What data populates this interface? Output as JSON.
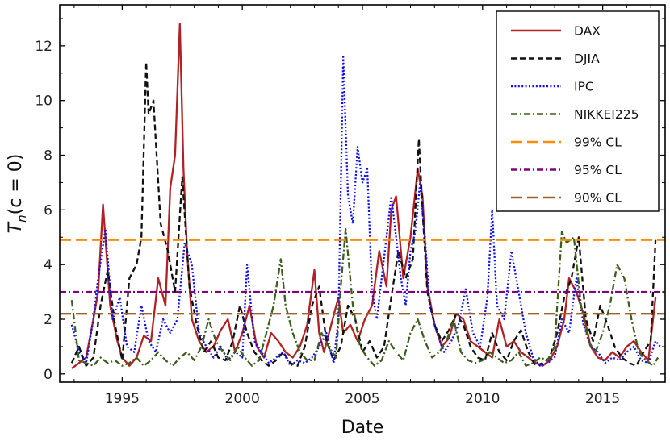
{
  "chart_data": {
    "type": "line",
    "xlabel": "Date",
    "ylabel": "T_n(c = 0)",
    "xlim": [
      1992.4,
      2017.6
    ],
    "ylim": [
      -0.3,
      13.5
    ],
    "x_ticks": [
      1995,
      2000,
      2005,
      2010,
      2015
    ],
    "y_ticks": [
      0,
      2,
      4,
      6,
      8,
      10,
      12
    ],
    "grid": false,
    "legend_position": "top-right",
    "series": [
      {
        "name": "DAX",
        "color": "#b22222",
        "style": "solid",
        "x": [
          1992.9,
          1993.2,
          1993.5,
          1993.8,
          1994.0,
          1994.2,
          1994.5,
          1994.8,
          1995.0,
          1995.3,
          1995.6,
          1995.9,
          1996.2,
          1996.5,
          1996.8,
          1997.0,
          1997.2,
          1997.4,
          1997.55,
          1997.7,
          1997.9,
          1998.2,
          1998.5,
          1998.8,
          1999.1,
          1999.4,
          1999.7,
          2000.0,
          2000.3,
          2000.6,
          2000.9,
          2001.2,
          2001.5,
          2001.8,
          2002.1,
          2002.4,
          2002.7,
          2003.0,
          2003.2,
          2003.4,
          2003.7,
          2004.0,
          2004.2,
          2004.5,
          2004.8,
          2005.1,
          2005.4,
          2005.7,
          2006.0,
          2006.2,
          2006.4,
          2006.7,
          2007.0,
          2007.3,
          2007.5,
          2007.7,
          2008.0,
          2008.3,
          2008.6,
          2008.9,
          2009.2,
          2009.5,
          2009.8,
          2010.1,
          2010.4,
          2010.7,
          2011.0,
          2011.3,
          2011.6,
          2011.9,
          2012.2,
          2012.5,
          2012.8,
          2013.1,
          2013.4,
          2013.6,
          2013.9,
          2014.2,
          2014.5,
          2014.8,
          2015.1,
          2015.4,
          2015.7,
          2016.0,
          2016.3,
          2016.6,
          2016.9,
          2017.2
        ],
        "y": [
          0.2,
          0.4,
          0.6,
          2.0,
          3.0,
          6.2,
          2.5,
          1.2,
          0.6,
          0.3,
          0.6,
          1.4,
          1.2,
          3.5,
          2.5,
          6.8,
          8.0,
          12.8,
          7.5,
          4.5,
          2.0,
          1.2,
          0.8,
          1.0,
          1.6,
          2.0,
          0.8,
          1.5,
          2.5,
          1.0,
          0.6,
          1.5,
          1.2,
          0.8,
          0.6,
          1.0,
          1.8,
          3.8,
          1.5,
          0.8,
          1.8,
          2.8,
          1.5,
          1.8,
          1.2,
          2.0,
          2.5,
          4.5,
          3.2,
          6.0,
          6.5,
          3.5,
          5.0,
          7.5,
          6.5,
          3.2,
          1.8,
          1.0,
          1.3,
          2.2,
          2.0,
          1.2,
          1.0,
          0.8,
          0.6,
          2.0,
          1.0,
          1.2,
          0.8,
          0.6,
          0.4,
          0.3,
          0.5,
          1.0,
          2.0,
          3.5,
          3.0,
          2.2,
          1.0,
          0.6,
          0.5,
          0.8,
          0.6,
          1.0,
          1.2,
          0.8,
          0.5,
          2.8
        ]
      },
      {
        "name": "DJIA",
        "color": "#111111",
        "style": "dashed",
        "x": [
          1992.9,
          1993.2,
          1993.5,
          1993.8,
          1994.1,
          1994.4,
          1994.7,
          1995.0,
          1995.3,
          1995.6,
          1995.8,
          1996.0,
          1996.1,
          1996.3,
          1996.6,
          1996.9,
          1997.2,
          1997.5,
          1997.8,
          1998.1,
          1998.4,
          1998.7,
          1999.0,
          1999.3,
          1999.6,
          1999.9,
          2000.2,
          2000.5,
          2000.8,
          2001.1,
          2001.4,
          2001.7,
          2002.0,
          2002.3,
          2002.6,
          2002.9,
          2003.2,
          2003.5,
          2003.8,
          2004.1,
          2004.4,
          2004.7,
          2005.0,
          2005.3,
          2005.6,
          2005.9,
          2006.2,
          2006.5,
          2006.8,
          2007.1,
          2007.35,
          2007.5,
          2007.7,
          2008.0,
          2008.3,
          2008.6,
          2008.9,
          2009.2,
          2009.5,
          2009.8,
          2010.1,
          2010.4,
          2010.7,
          2011.0,
          2011.3,
          2011.6,
          2011.9,
          2012.2,
          2012.5,
          2012.8,
          2013.1,
          2013.4,
          2013.7,
          2014.0,
          2014.3,
          2014.6,
          2014.9,
          2015.2,
          2015.5,
          2015.8,
          2016.1,
          2016.4,
          2016.7,
          2017.0,
          2017.2
        ],
        "y": [
          0.4,
          1.0,
          0.3,
          0.6,
          2.5,
          3.8,
          1.8,
          0.5,
          3.5,
          4.0,
          5.0,
          11.4,
          9.5,
          10.0,
          5.5,
          4.5,
          3.0,
          7.2,
          3.2,
          1.8,
          0.8,
          1.2,
          0.6,
          0.5,
          1.2,
          2.5,
          1.5,
          0.8,
          0.5,
          0.3,
          0.5,
          0.8,
          0.4,
          0.3,
          1.0,
          2.5,
          3.2,
          1.2,
          0.5,
          1.0,
          2.5,
          2.0,
          0.8,
          1.2,
          0.6,
          1.0,
          2.8,
          4.5,
          3.5,
          4.2,
          8.6,
          6.0,
          3.0,
          1.8,
          1.2,
          1.6,
          2.2,
          1.8,
          1.0,
          0.6,
          0.5,
          1.5,
          0.8,
          0.5,
          1.2,
          1.6,
          0.8,
          0.3,
          0.4,
          0.6,
          1.5,
          2.8,
          3.5,
          5.0,
          2.0,
          1.2,
          2.5,
          1.8,
          1.0,
          0.6,
          0.4,
          0.3,
          0.8,
          1.2,
          4.9
        ]
      },
      {
        "name": "IPC",
        "color": "#1010e8",
        "style": "dotted",
        "x": [
          1992.9,
          1993.2,
          1993.5,
          1993.8,
          1994.0,
          1994.3,
          1994.6,
          1994.9,
          1995.2,
          1995.5,
          1995.8,
          1996.1,
          1996.4,
          1996.7,
          1997.0,
          1997.3,
          1997.6,
          1997.9,
          1998.2,
          1998.5,
          1998.8,
          1999.1,
          1999.4,
          1999.7,
          2000.0,
          2000.2,
          2000.5,
          2000.8,
          2001.1,
          2001.4,
          2001.7,
          2002.0,
          2002.3,
          2002.6,
          2002.9,
          2003.2,
          2003.5,
          2003.8,
          2004.0,
          2004.2,
          2004.4,
          2004.6,
          2004.8,
          2005.0,
          2005.2,
          2005.4,
          2005.6,
          2005.8,
          2006.0,
          2006.2,
          2006.4,
          2006.6,
          2006.8,
          2007.0,
          2007.2,
          2007.4,
          2007.6,
          2007.8,
          2008.1,
          2008.4,
          2008.7,
          2009.0,
          2009.3,
          2009.6,
          2009.9,
          2010.2,
          2010.4,
          2010.6,
          2010.9,
          2011.2,
          2011.5,
          2011.8,
          2012.1,
          2012.4,
          2012.7,
          2013.0,
          2013.3,
          2013.6,
          2013.9,
          2014.2,
          2014.5,
          2014.8,
          2015.1,
          2015.4,
          2015.7,
          2016.0,
          2016.3,
          2016.6,
          2016.9,
          2017.2,
          2017.4
        ],
        "y": [
          1.8,
          0.8,
          0.4,
          2.0,
          3.5,
          5.3,
          2.0,
          2.8,
          1.0,
          0.8,
          2.5,
          1.2,
          0.8,
          2.0,
          1.5,
          2.0,
          4.8,
          4.0,
          1.5,
          1.0,
          0.6,
          1.0,
          0.5,
          0.8,
          0.6,
          4.0,
          1.2,
          0.8,
          0.4,
          0.6,
          0.8,
          0.3,
          0.5,
          0.4,
          0.6,
          1.0,
          1.5,
          0.4,
          2.0,
          11.6,
          6.5,
          5.5,
          8.3,
          7.0,
          7.5,
          3.0,
          2.0,
          3.5,
          5.0,
          6.5,
          5.0,
          3.5,
          2.5,
          4.5,
          5.2,
          7.0,
          5.0,
          2.5,
          1.5,
          0.8,
          1.2,
          1.8,
          3.1,
          1.5,
          1.0,
          2.8,
          6.0,
          2.5,
          2.0,
          4.5,
          3.0,
          1.5,
          0.6,
          0.3,
          0.4,
          0.6,
          2.0,
          1.5,
          3.5,
          1.8,
          1.0,
          0.8,
          0.4,
          0.6,
          0.5,
          0.8,
          1.0,
          0.5,
          0.4,
          1.2,
          1.0
        ]
      },
      {
        "name": "NIKKEI225",
        "color": "#3e5e1e",
        "style": "dashdot",
        "x": [
          1992.9,
          1993.2,
          1993.5,
          1993.8,
          1994.1,
          1994.4,
          1994.7,
          1995.0,
          1995.3,
          1995.6,
          1995.9,
          1996.2,
          1996.5,
          1996.8,
          1997.1,
          1997.4,
          1997.7,
          1998.0,
          1998.3,
          1998.6,
          1998.9,
          1999.2,
          1999.5,
          1999.8,
          2000.1,
          2000.4,
          2000.7,
          2001.0,
          2001.3,
          2001.6,
          2001.8,
          2002.1,
          2002.4,
          2002.7,
          2003.0,
          2003.3,
          2003.6,
          2003.9,
          2004.1,
          2004.3,
          2004.6,
          2004.9,
          2005.2,
          2005.5,
          2005.8,
          2006.1,
          2006.4,
          2006.7,
          2007.0,
          2007.3,
          2007.6,
          2007.9,
          2008.2,
          2008.5,
          2008.8,
          2009.1,
          2009.4,
          2009.7,
          2010.0,
          2010.3,
          2010.6,
          2010.9,
          2011.2,
          2011.5,
          2011.8,
          2012.1,
          2012.4,
          2012.7,
          2013.0,
          2013.3,
          2013.5,
          2013.8,
          2014.1,
          2014.4,
          2014.7,
          2015.0,
          2015.3,
          2015.6,
          2015.9,
          2016.2,
          2016.5,
          2016.8,
          2017.1,
          2017.3
        ],
        "y": [
          2.7,
          0.5,
          0.4,
          0.3,
          0.6,
          0.4,
          0.5,
          0.3,
          0.4,
          0.6,
          0.3,
          0.5,
          0.8,
          0.5,
          0.3,
          0.6,
          0.8,
          0.5,
          1.0,
          2.0,
          1.2,
          0.8,
          0.5,
          1.0,
          0.6,
          0.3,
          0.5,
          1.5,
          2.5,
          4.2,
          2.5,
          1.5,
          0.8,
          0.5,
          0.5,
          1.5,
          1.0,
          0.6,
          3.2,
          5.3,
          2.5,
          1.0,
          0.6,
          0.3,
          0.5,
          1.2,
          0.8,
          0.5,
          1.5,
          2.0,
          1.2,
          0.6,
          0.8,
          1.2,
          2.0,
          0.8,
          0.5,
          0.4,
          0.5,
          0.8,
          0.6,
          0.4,
          0.5,
          0.8,
          0.3,
          0.4,
          0.6,
          0.5,
          1.0,
          5.2,
          4.8,
          5.0,
          2.5,
          1.2,
          0.8,
          1.5,
          2.5,
          4.0,
          3.5,
          2.0,
          0.8,
          0.5,
          0.3,
          0.6
        ]
      }
    ],
    "reference_lines": [
      {
        "name": "99% CL",
        "y": 4.9,
        "color": "#ff8c00",
        "style": "longdash"
      },
      {
        "name": "95% CL",
        "y": 3.0,
        "color": "#800080",
        "style": "dashdot"
      },
      {
        "name": "90% CL",
        "y": 2.2,
        "color": "#a0622d",
        "style": "longdash"
      }
    ]
  }
}
